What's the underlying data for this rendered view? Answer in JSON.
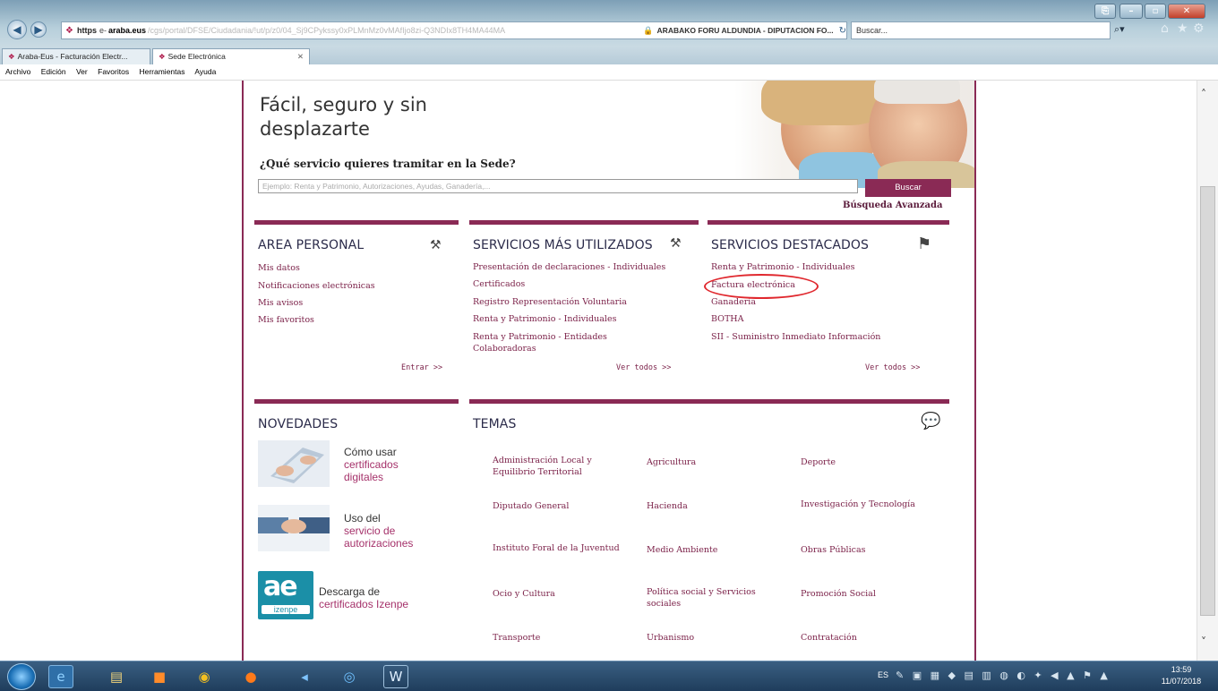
{
  "browser": {
    "url_scheme": "https",
    "url_domain_prefix": "e-",
    "url_domain": "araba.eus",
    "url_path": "/cgs/portal/DFSE/Ciudadania/!ut/p/z0/04_Sj9CPykssy0xPLMnMz0vMAfIjo8zi-Q3NDIx8TH4MA44MA",
    "site_identity": "ARABAKO FORU ALDUNDIA - DIPUTACION FO...",
    "search_placeholder": "Buscar...",
    "tabs": [
      {
        "label": "Araba-Eus - Facturación Electr..."
      },
      {
        "label": "Sede Electrónica"
      }
    ],
    "menu": [
      "Archivo",
      "Edición",
      "Ver",
      "Favoritos",
      "Herramientas",
      "Ayuda"
    ]
  },
  "hero": {
    "title": "Fácil, seguro y sin desplazarte",
    "question": "¿Qué servicio quieres tramitar en la Sede?",
    "search_placeholder": "Ejemplo: Renta y Patrimonio, Autorizaciones, Ayudas, Ganadería,...",
    "search_button": "Buscar",
    "advanced_link": "Búsqueda Avanzada"
  },
  "area_personal": {
    "title": "AREA PERSONAL",
    "links": [
      "Mis datos",
      "Notificaciones electrónicas",
      "Mis avisos",
      "Mis favoritos"
    ],
    "more": "Entrar >>"
  },
  "servicios_utilizados": {
    "title": "SERVICIOS MÁS UTILIZADOS",
    "links": [
      "Presentación de declaraciones - Individuales",
      "Certificados",
      "Registro Representación Voluntaria",
      "Renta y Patrimonio - Individuales",
      "Renta y Patrimonio - Entidades",
      "Colaboradoras"
    ],
    "more": "Ver todos >>"
  },
  "servicios_destacados": {
    "title": "SERVICIOS DESTACADOS",
    "links": [
      "Renta y Patrimonio - Individuales",
      "Factura electrónica",
      "Ganadería",
      "BOTHA",
      "SII - Suministro Inmediato Información"
    ],
    "more": "Ver todos >>"
  },
  "novedades": {
    "title": "NOVEDADES",
    "items": [
      {
        "line1": "Cómo usar",
        "line2": "certificados",
        "line3": "digitales"
      },
      {
        "line1": "Uso del",
        "line2": "servicio de",
        "line3": "autorizaciones"
      },
      {
        "line1": "Descarga de",
        "line2": "certificados Izenpe",
        "logo_big": "ae",
        "logo_small": "izenpe"
      }
    ]
  },
  "temas": {
    "title": "TEMAS",
    "items": [
      "Administración Local y Equilibrio Territorial",
      "Agricultura",
      "Deporte",
      "Diputado General",
      "Hacienda",
      "Investigación y Tecnología",
      "Instituto Foral de la Juventud",
      "Medio Ambiente",
      "Obras Públicas",
      "Ocio y Cultura",
      "Política social y Servicios sociales",
      "Promoción Social",
      "Transporte",
      "Urbanismo",
      "Contratación"
    ]
  },
  "taskbar": {
    "lang": "ES",
    "time": "13:59",
    "date": "11/07/2018"
  },
  "colors": {
    "brand": "#8a2a55",
    "link": "#7a1f47",
    "highlight_oval": "#e0282e"
  }
}
